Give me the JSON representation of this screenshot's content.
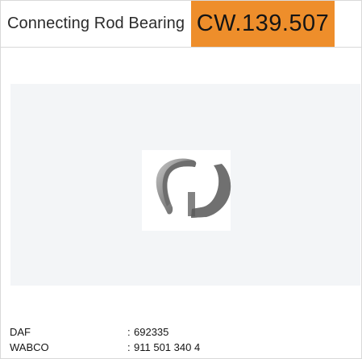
{
  "header": {
    "title": "Connecting Rod Bearing",
    "code": "CW.139.507"
  },
  "colors": {
    "accent": "#ee8e2b",
    "panel": "#f3f5f7",
    "border": "#d9d9d9"
  },
  "product": {
    "image_icon": "connecting-rod-bearing-icon"
  },
  "specs": [
    {
      "brand": "DAF",
      "separator": ":",
      "value": "692335"
    },
    {
      "brand": "WABCO",
      "separator": ":",
      "value": "911 501 340 4"
    }
  ]
}
